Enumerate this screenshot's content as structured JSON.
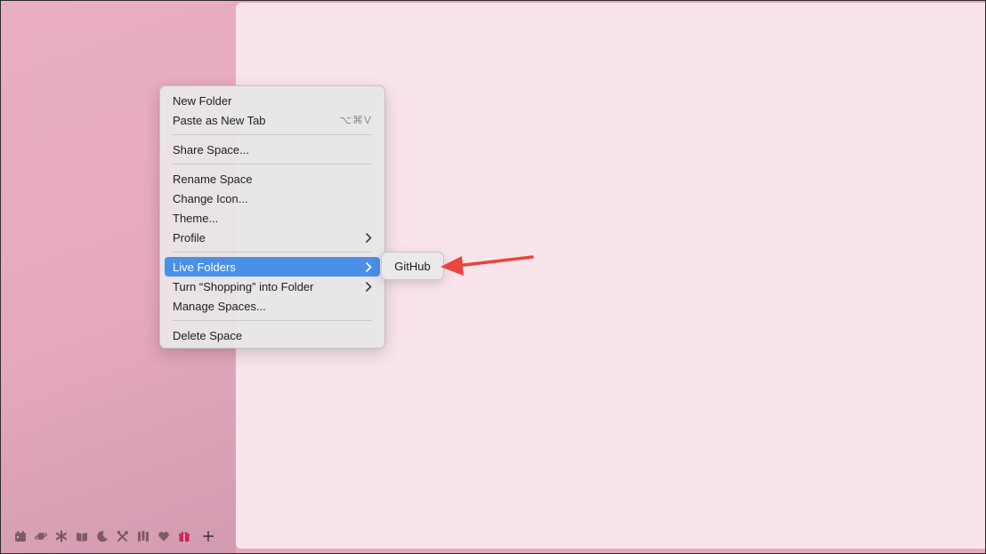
{
  "context_menu": {
    "new_folder": "New Folder",
    "paste_as_new_tab": "Paste as New Tab",
    "paste_shortcut": "⌥⌘V",
    "share_space": "Share Space...",
    "rename_space": "Rename Space",
    "change_icon": "Change Icon...",
    "theme": "Theme...",
    "profile": "Profile",
    "live_folders": "Live Folders",
    "turn_into_folder": "Turn “Shopping” into Folder",
    "manage_spaces": "Manage Spaces...",
    "delete_space": "Delete Space"
  },
  "submenu": {
    "items": [
      "GitHub"
    ]
  },
  "spaces_bar": {
    "icons": [
      "calendar-icon",
      "planet-icon",
      "asterisk-icon",
      "book-icon",
      "moon-icon",
      "tools-icon",
      "stripes-icon",
      "heart-icon",
      "gift-icon",
      "plus-icon"
    ]
  },
  "colors": {
    "sidebar": "#e8a7bd",
    "content": "#f9e4eb",
    "menu_highlight": "#4a90e7",
    "annotation_arrow": "#e8453c"
  }
}
